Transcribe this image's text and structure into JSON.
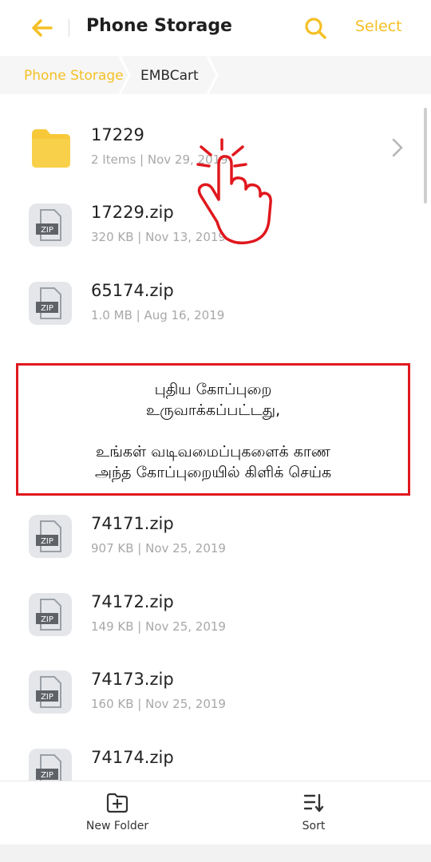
{
  "header": {
    "title": "Phone Storage",
    "select_label": "Select"
  },
  "breadcrumb": [
    "Phone Storage",
    "EMBCart"
  ],
  "items": [
    {
      "name": "17229",
      "meta": "2 Items | Nov 29, 2019",
      "type": "folder"
    },
    {
      "name": "17229.zip",
      "meta": "320 KB | Nov 13, 2019",
      "type": "zip"
    },
    {
      "name": "65174.zip",
      "meta": "1.0 MB | Aug 16, 2019",
      "type": "zip"
    },
    {
      "name": "74171.zip",
      "meta": "907 KB | Nov 25, 2019",
      "type": "zip"
    },
    {
      "name": "74172.zip",
      "meta": "149 KB | Nov 25, 2019",
      "type": "zip"
    },
    {
      "name": "74173.zip",
      "meta": "160 KB | Nov 25, 2019",
      "type": "zip"
    },
    {
      "name": "74174.zip",
      "meta": "",
      "type": "zip"
    }
  ],
  "zip_badge": "ZIP",
  "notice": {
    "line1": "புதிய கோப்புறை",
    "line2": "உருவாக்கப்பட்டது,",
    "line3": "உங்கள் வடிவமைப்புகளைக் காண",
    "line4": "அந்த கோப்புறையில் கிளிக் செய்க"
  },
  "bottom_bar": {
    "new_folder": "New Folder",
    "sort": "Sort"
  },
  "icons": {
    "back": "arrow-left-icon",
    "search": "search-icon",
    "hand": "tap-hand-icon"
  },
  "colors": {
    "accent": "#f5c025",
    "notice_border": "#e0181e",
    "hand": "#e0181e"
  }
}
